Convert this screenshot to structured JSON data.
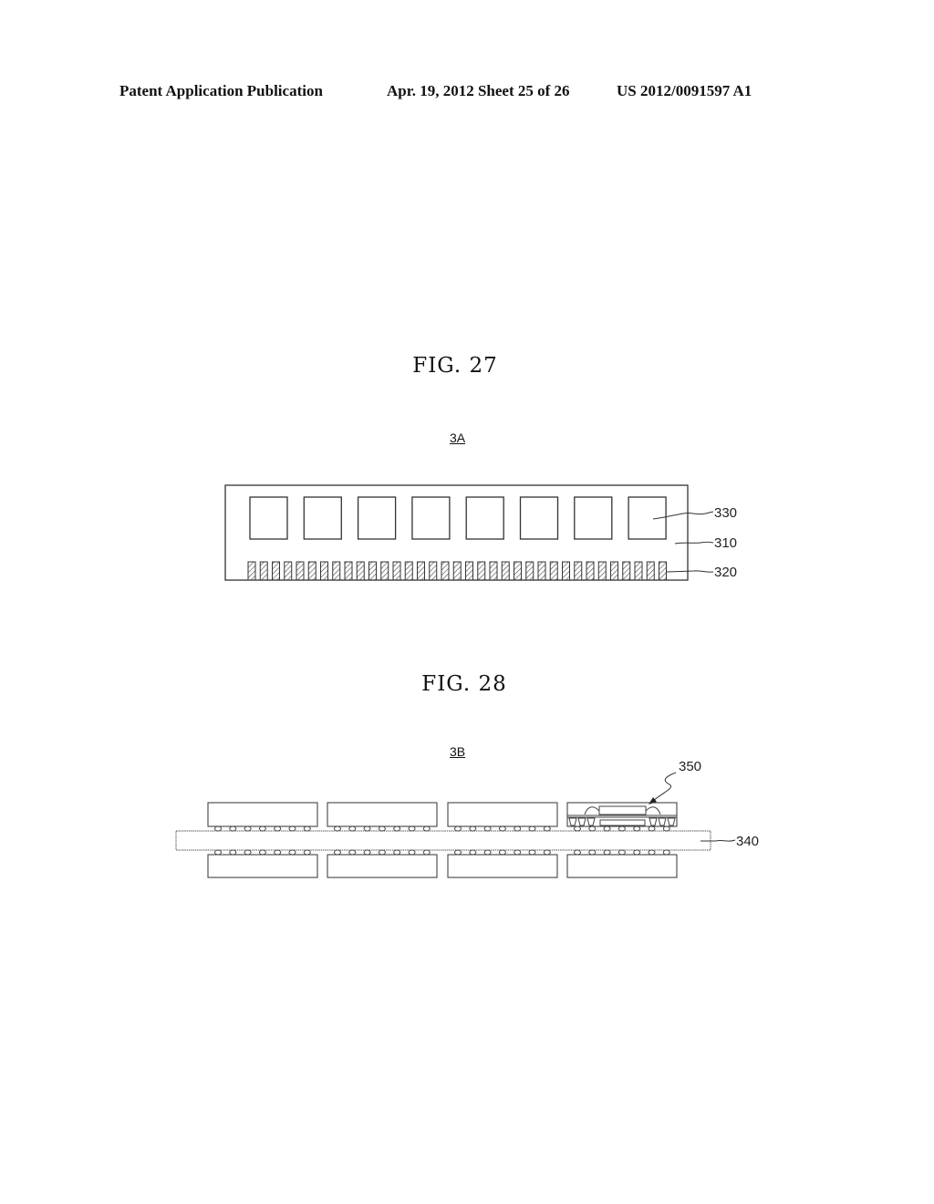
{
  "header": {
    "left": "Patent Application Publication",
    "middle": "Apr. 19, 2012  Sheet 25 of 26",
    "right": "US 2012/0091597 A1"
  },
  "fig27": {
    "title": "FIG.  27",
    "ref": "3A",
    "chip_count": 8,
    "pin_count": 35,
    "labels": {
      "chip": "330",
      "board": "310",
      "pins": "320"
    }
  },
  "fig28": {
    "title": "FIG.  28",
    "ref": "3B",
    "package_pairs": 4,
    "balls_per_package": 7,
    "labels": {
      "stacked_package": "350",
      "board": "340"
    }
  }
}
